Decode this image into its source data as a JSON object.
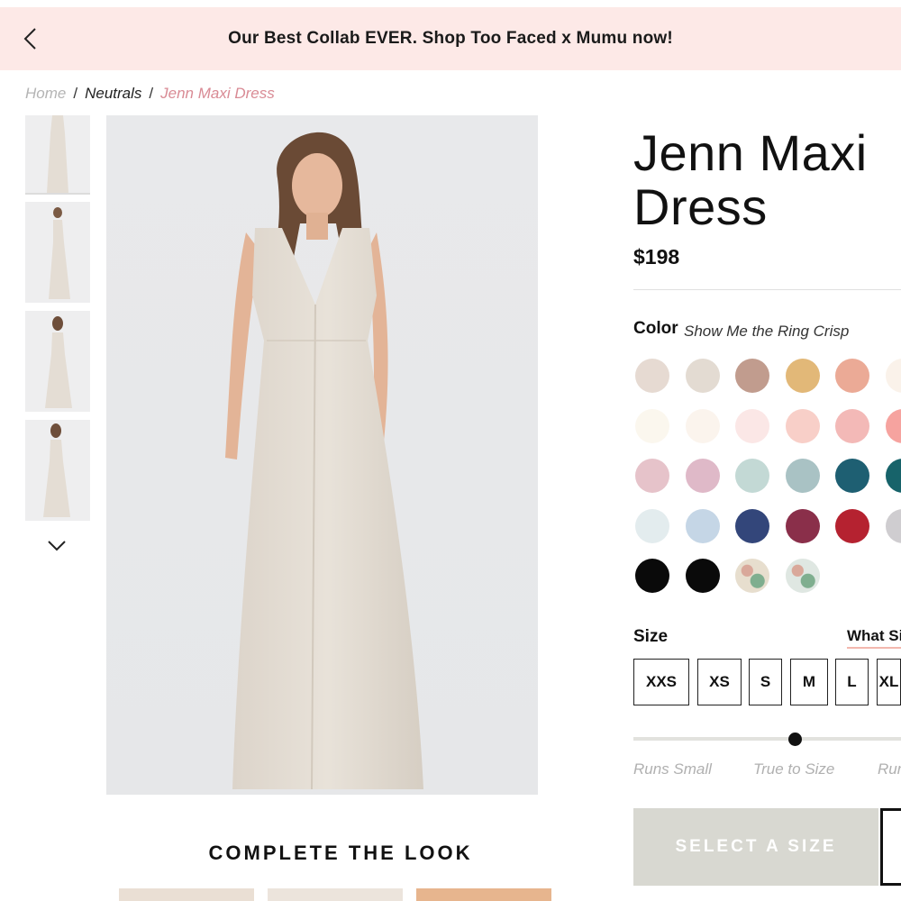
{
  "promo": {
    "text": "Our Best Collab EVER. Shop Too Faced x Mumu now!",
    "back_icon": "chevron-left-icon"
  },
  "breadcrumb": {
    "home": "Home",
    "separator": "/",
    "category": "Neutrals",
    "current": "Jenn Maxi Dress"
  },
  "gallery": {
    "thumbnail_count": 4,
    "next_icon": "chevron-down-icon"
  },
  "complete_look": {
    "title": "COMPLETE THE LOOK"
  },
  "product": {
    "title_line1": "Jenn Maxi",
    "title_line2": "Dress",
    "price": "$198"
  },
  "color": {
    "label": "Color",
    "selected": "Show Me the Ring Crisp",
    "swatches": [
      "#e6dad2",
      "#e3dbd2",
      "#c19c8e",
      "#e2b878",
      "#ebaa96",
      "#faf2ea",
      "#fbf7ee",
      "#fbf4ed",
      "#fbe7e6",
      "#f8cfc8",
      "#f3b9b7",
      "#f6a39f",
      "#e6c3ca",
      "#dfb9c8",
      "#c3d9d5",
      "#a9c2c4",
      "#1e5f72",
      "#17636a",
      "#e3ecee",
      "#c5d6e6",
      "#33467a",
      "#8a2f4a",
      "#b52230",
      "#cfcdd0",
      "#0a0a0a",
      "#0a0a0a",
      "#e7dece",
      "#dfe7e2"
    ]
  },
  "size": {
    "label": "Size",
    "guide_link": "What Si",
    "options": [
      "XXS",
      "XS",
      "S",
      "M",
      "L",
      "XL"
    ]
  },
  "fit": {
    "runs_small": "Runs Small",
    "true_to_size": "True to Size",
    "runs_large": "Runs"
  },
  "cta": {
    "select_size": "SELECT A SIZE"
  },
  "colors": {
    "promo_bg": "#fde9e7",
    "accent_pink": "#d98b95",
    "cta_bg": "#d8d8d1"
  }
}
